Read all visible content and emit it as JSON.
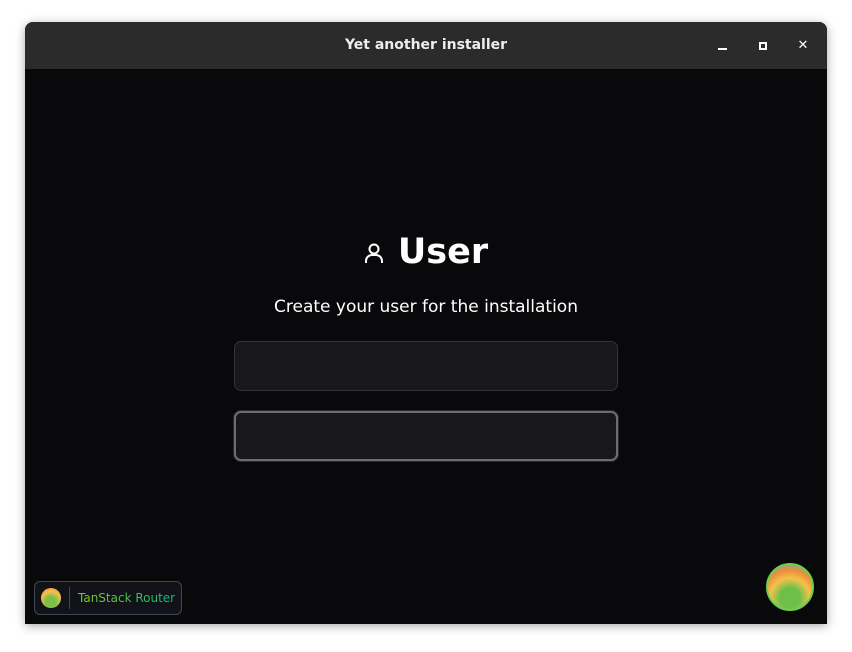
{
  "window": {
    "title": "Yet another installer",
    "controls": {
      "minimize": "–",
      "maximize": "□",
      "close": "✕"
    }
  },
  "main": {
    "heading": "User",
    "subtitle": "Create your user for the installation",
    "inputs": [
      {
        "value": "",
        "placeholder": ""
      },
      {
        "value": "",
        "placeholder": ""
      }
    ]
  },
  "devtools": {
    "label": "TanStack Router"
  }
}
